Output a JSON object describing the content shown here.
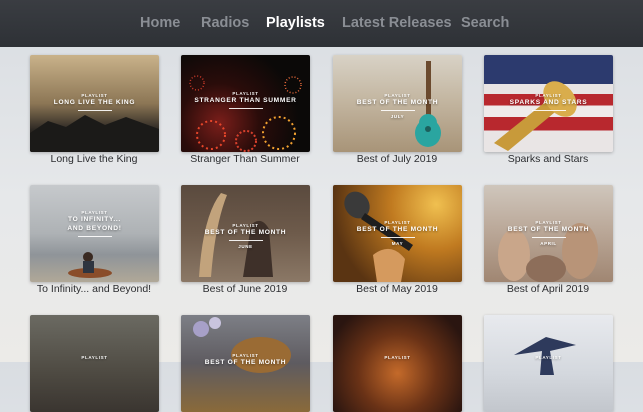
{
  "nav": {
    "tabs": [
      {
        "label": "Home",
        "active": false
      },
      {
        "label": "Radios",
        "active": false
      },
      {
        "label": "Playlists",
        "active": true
      },
      {
        "label": "Latest Releases",
        "active": false
      },
      {
        "label": "Search",
        "active": false
      }
    ]
  },
  "playlists": [
    {
      "caption": "Long Live the King",
      "kicker": "PLAYLIST",
      "overlay_title": [
        "LONG LIVE THE KING"
      ],
      "month": ""
    },
    {
      "caption": "Stranger Than Summer",
      "kicker": "PLAYLIST",
      "overlay_title": [
        "STRANGER THAN SUMMER"
      ],
      "month": ""
    },
    {
      "caption": "Best of July 2019",
      "kicker": "PLAYLIST",
      "overlay_title": [
        "BEST OF THE MONTH"
      ],
      "month": "JULY"
    },
    {
      "caption": "Sparks and Stars",
      "kicker": "PLAYLIST",
      "overlay_title": [
        "SPARKS AND STARS"
      ],
      "month": ""
    },
    {
      "caption": "To Infinity... and Beyond!",
      "kicker": "PLAYLIST",
      "overlay_title": [
        "TO INFINITY...",
        "AND BEYOND!"
      ],
      "month": ""
    },
    {
      "caption": "Best of June 2019",
      "kicker": "PLAYLIST",
      "overlay_title": [
        "BEST OF THE MONTH"
      ],
      "month": "JUNE"
    },
    {
      "caption": "Best of May 2019",
      "kicker": "PLAYLIST",
      "overlay_title": [
        "BEST OF THE MONTH"
      ],
      "month": "MAY"
    },
    {
      "caption": "Best of April 2019",
      "kicker": "PLAYLIST",
      "overlay_title": [
        "BEST OF THE MONTH"
      ],
      "month": "APRIL"
    },
    {
      "caption": "",
      "kicker": "PLAYLIST",
      "overlay_title": [],
      "month": ""
    },
    {
      "caption": "",
      "kicker": "PLAYLIST",
      "overlay_title": [
        "BEST OF THE MONTH"
      ],
      "month": ""
    },
    {
      "caption": "",
      "kicker": "PLAYLIST",
      "overlay_title": [],
      "month": ""
    },
    {
      "caption": "",
      "kicker": "PLAYLIST",
      "overlay_title": [],
      "month": ""
    }
  ],
  "colors": {
    "nav_background": "#2f3237",
    "nav_active": "#ffffff",
    "nav_inactive": "#8a8e94",
    "caption_text": "#2c2d30"
  }
}
